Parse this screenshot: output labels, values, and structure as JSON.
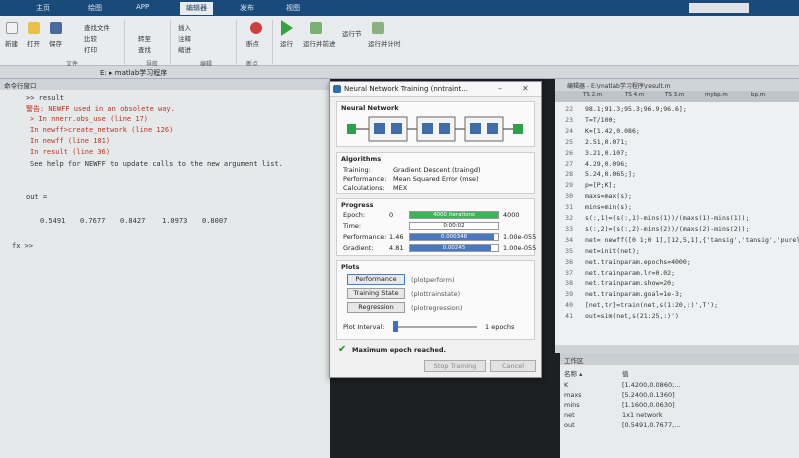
{
  "top_tabs": [
    "主页",
    "绘图",
    "APP",
    "编辑器",
    "发布",
    "视图"
  ],
  "ribbon": {
    "file": [
      "新建",
      "打开",
      "保存"
    ],
    "find_files": "查找文件",
    "compare": "比较",
    "print": "打印",
    "goto": "转至",
    "find": "查找",
    "insert": "插入",
    "comment": "注释",
    "indent": "缩进",
    "breakpoints": "断点",
    "run": "运行",
    "run_advance": "运行并前进",
    "run_section": "运行节",
    "run_time": "运行并计时",
    "groups": [
      "文件",
      "导航",
      "编辑",
      "断点"
    ]
  },
  "address": {
    "path": "E: ▸ matlab学习程序"
  },
  "command_window": {
    "header": "命令行窗口",
    "lines": [
      {
        "text": ">> result",
        "cls": ""
      },
      {
        "text": "警告: NEWFF used in an obsolete way.",
        "cls": "red"
      },
      {
        "text": "> In nnerr.obs_use (line 17)",
        "cls": "red"
      },
      {
        "text": "  In newff>create_network (line 126)",
        "cls": "red"
      },
      {
        "text": "  In newff (line 101)",
        "cls": "red"
      },
      {
        "text": "  In result (line 36)",
        "cls": "red"
      },
      {
        "text": "    See help for NEWFF to update calls to the new argument list.",
        "cls": ""
      }
    ],
    "out_label": "out =",
    "out_values": [
      "0.5491",
      "0.7677",
      "0.8427",
      "1.0973",
      "0.8007"
    ],
    "prompt": "fx >>"
  },
  "editor": {
    "header": "编辑器 - E:\\matlab学习程序\\result.m",
    "tabs": [
      "TS 2.m",
      "TS 4.m",
      "TS 3.m",
      "mybp.m",
      "bp.m"
    ],
    "lines": [
      {
        "n": "22",
        "code": "    98.1;91.3;95.3;96.9;96.6];"
      },
      {
        "n": "23",
        "code": "T=T/100;"
      },
      {
        "n": "24",
        "code": "K=[1.42,0.086;"
      },
      {
        "n": "25",
        "code": "   2.51,0.071;"
      },
      {
        "n": "26",
        "code": "   3.21,0.107;"
      },
      {
        "n": "27",
        "code": "   4.29,0.096;"
      },
      {
        "n": "28",
        "code": "   5.24,0.065;];"
      },
      {
        "n": "29",
        "code": "p=[P;K];"
      },
      {
        "n": "30",
        "code": "maxs=max(s);"
      },
      {
        "n": "31",
        "code": "mins=min(s);"
      },
      {
        "n": "32",
        "code": "s(:,1)=(s(:,1)-mins(1))/(maxs(1)-mins(1));"
      },
      {
        "n": "33",
        "code": "s(:,2)=(s(:,2)-mins(2))/(maxs(2)-mins(2));"
      },
      {
        "n": "34",
        "code": "net= newff([0 1;0 1],[12,5,1],{'tansig','tansig','purelin'});"
      },
      {
        "n": "35",
        "code": "net=init(net);"
      },
      {
        "n": "36",
        "code": "net.trainparam.epochs=4000;"
      },
      {
        "n": "37",
        "code": "net.trainparam.lr=0.02;"
      },
      {
        "n": "38",
        "code": "net.trainparam.show=20;"
      },
      {
        "n": "39",
        "code": "net.trainparam.goal=1e-3;"
      },
      {
        "n": "40",
        "code": "[net,tr]=train(net,s(1:20,:)',T');"
      },
      {
        "n": "41",
        "code": "out=sim(net,s(21:25,:)')"
      }
    ]
  },
  "workspace": {
    "header": "工作区",
    "col_name": "名称 ▴",
    "col_value": "值",
    "rows": [
      {
        "name": "K",
        "value": "[1.4200,0.0860;..."
      },
      {
        "name": "maxs",
        "value": "[5.2400,0.1360]"
      },
      {
        "name": "mins",
        "value": "[1.1600,0.0630]"
      },
      {
        "name": "net",
        "value": "1x1 network"
      },
      {
        "name": "out",
        "value": "[0.5491,0.7677,..."
      }
    ]
  },
  "dialog": {
    "title": "Neural Network Training (nntraint...",
    "network_header": "Neural Network",
    "algorithms_header": "Algorithms",
    "training_label": "Training:",
    "training_value": "Gradient Descent  (traingd)",
    "performance_label": "Performance:",
    "performance_value": "Mean Squared Error  (mse)",
    "calculations_label": "Calculations:",
    "calculations_value": "MEX",
    "progress_header": "Progress",
    "progress": [
      {
        "label": "Epoch:",
        "start": "0",
        "bar_text": "4000 iterations",
        "end": "4000",
        "fill_pct": 100,
        "color": "green"
      },
      {
        "label": "Time:",
        "start": "",
        "bar_text": "0:00:02",
        "end": "",
        "fill_pct": 0,
        "color": "none"
      },
      {
        "label": "Performance:",
        "start": "1.46",
        "bar_text": "0.000348",
        "end": "1.00e-055",
        "fill_pct": 95,
        "color": "blue"
      },
      {
        "label": "Gradient:",
        "start": "4.81",
        "bar_text": "0.00245",
        "end": "1.00e-055",
        "fill_pct": 92,
        "color": "blue"
      }
    ],
    "plots_header": "Plots",
    "plot_buttons": [
      {
        "label": "Performance",
        "fn": "(plotperform)"
      },
      {
        "label": "Training State",
        "fn": "(plottrainstate)"
      },
      {
        "label": "Regression",
        "fn": "(plotregression)"
      }
    ],
    "plot_interval_label": "Plot Interval:",
    "plot_interval_value": "1 epochs",
    "status": "Maximum epoch reached.",
    "stop_button": "Stop Training",
    "cancel_button": "Cancel"
  }
}
